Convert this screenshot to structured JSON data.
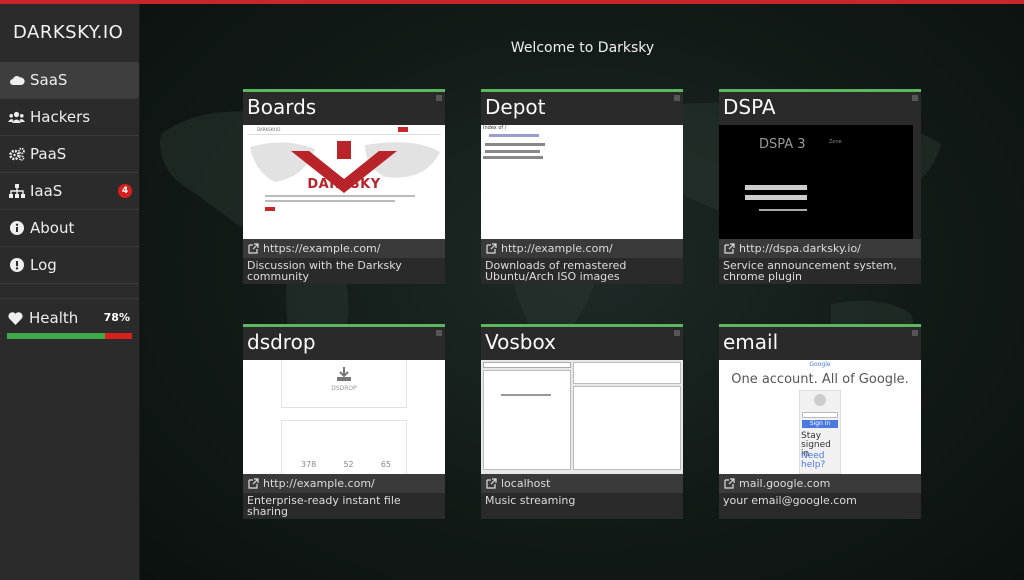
{
  "brand": "DARKSKY.IO",
  "nav": [
    {
      "label": "SaaS",
      "icon": "cloud-icon"
    },
    {
      "label": "Hackers",
      "icon": "users-icon"
    },
    {
      "label": "PaaS",
      "icon": "gears-icon"
    },
    {
      "label": "IaaS",
      "icon": "sitemap-icon",
      "badge": "4"
    },
    {
      "label": "About",
      "icon": "info-icon"
    },
    {
      "label": "Log",
      "icon": "alert-icon"
    }
  ],
  "health": {
    "label": "Health",
    "percent_text": "78%",
    "value": 0.78
  },
  "welcome": "Welcome to Darksky",
  "cards": [
    {
      "title": "Boards",
      "url": "https://example.com/",
      "desc": "Discussion with the Darksky community",
      "thumb": {
        "logo": "DARKSKY",
        "header": "DARKSKY.IO"
      }
    },
    {
      "title": "Depot",
      "url": "http://example.com/",
      "desc": "Downloads of remastered Ubuntu/Arch ISO images",
      "thumb": {
        "heading": "Index of /"
      }
    },
    {
      "title": "DSPA",
      "url": "http://dspa.darksky.io/",
      "desc": "Service announcement system, chrome plugin",
      "thumb": {
        "heading": "DSPA 3",
        "side": "Zone"
      }
    },
    {
      "title": "dsdrop",
      "url": "http://example.com/",
      "desc": "Enterprise-ready instant file sharing",
      "thumb": {
        "heading": "DSDROP",
        "stats": [
          "378",
          "52",
          "65"
        ]
      }
    },
    {
      "title": "Vosbox",
      "url": "localhost",
      "desc": "Music streaming",
      "thumb": {}
    },
    {
      "title": "email",
      "url": "mail.google.com",
      "desc": "your email@google.com",
      "thumb": {
        "brand": "Google",
        "heading": "One account. All of Google.",
        "signin": "Sign in",
        "stay": "Stay signed in",
        "help": "Need help?"
      }
    }
  ],
  "colors": {
    "accent_green": "#5cb85c",
    "danger_red": "#d9201e",
    "top_bar": "#c8262b"
  }
}
